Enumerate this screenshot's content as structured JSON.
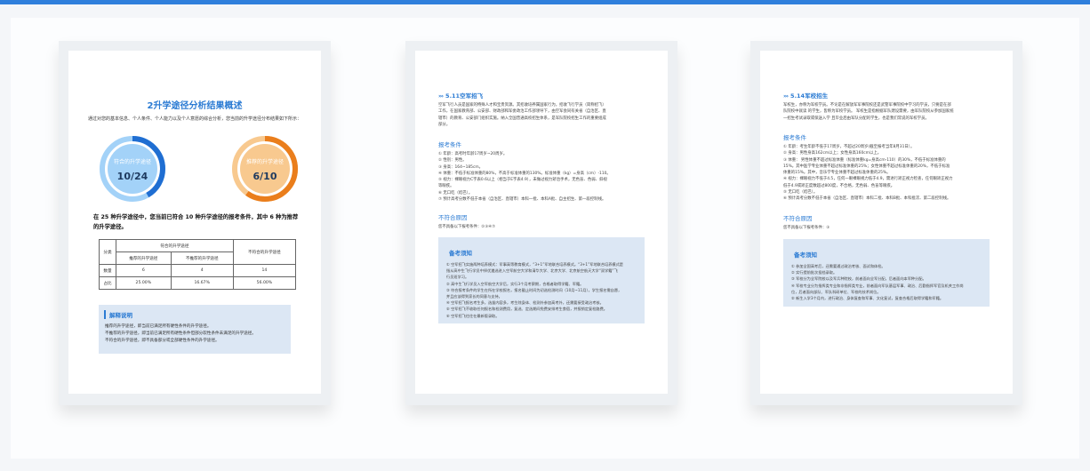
{
  "colors": {
    "accent": "#2b7bd3",
    "ring_blue_dark": "#1f6ed2",
    "ring_blue_light": "#a3d2f8",
    "ring_orange_dark": "#ea7e1c",
    "ring_orange_light": "#f8c98f",
    "note_bg": "#dce7f4"
  },
  "page1": {
    "title": "2升学途径分析结果概述",
    "intro": "通过对您的基本信息、个人条件、个人能力以及个人意愿的综合分析，您当前的升学途径分布结果如下所示：",
    "ring_match": {
      "label": "符合的升学途径",
      "value": "10/24",
      "fraction": 0.4167
    },
    "ring_recommend": {
      "label": "推荐的升学途径",
      "value": "6/10",
      "fraction": 0.6
    },
    "summary": "在 25 种升学途径中，您当前已符合 10 种升学途径的报考条件，其中 6 种为推荐的升学途径。",
    "table": {
      "head_category": "分类",
      "head_match": "符合的升学途径",
      "head_recommend": "推荐的升学途径",
      "head_not_recommend": "不推荐的升学途径",
      "head_not_match": "不符合的升学途径",
      "row_count": {
        "label": "数量",
        "recommend": "6",
        "not_recommend": "4",
        "not_match": "14"
      },
      "row_ratio": {
        "label": "占比",
        "recommend": "25.00%",
        "not_recommend": "16.67%",
        "not_match": "56.00%"
      }
    },
    "explain": {
      "title": "解释说明",
      "lines": [
        "推荐的升学途径，即当前已满足所有硬性条件的升学途径。",
        "不推荐的升学途径，即当前已满足所有硬性条件但部分软性条件未满足的升学途径。",
        "不符合的升学途径，即不具备部分或全部硬性条件的升学途径。"
      ]
    }
  },
  "page2": {
    "section": "5.11空军招飞",
    "intro": [
      "空军飞行人员是国家的特殊人才和宝贵资源。其招收培养属国家行为，招收飞行学员（简称招飞）",
      "工作，在国家教育部、公安部、财政部和军委政治工作部领导下，由空军会同有关省（自治区、直",
      "辖市）的教育、公安部门组织实施。纳入全国普通高校招生体系，是军队院校招生工作的重要组成",
      "部分。"
    ],
    "cond_title": "报考条件",
    "conditions": [
      "① 年龄：高考时年龄17周岁~20周岁。",
      "② 性别：男性。",
      "③ 身高：164~185cm。",
      "④ 体重：不低于标准体重的80%，不高于标准体重的130%。标准体重（kg）=身高（cm）-110。",
      "⑤ 视力：裸眼视力C字表0.6以上（相当于E字表4.9），未做过视力矫治手术，无色盲、色弱、斜视",
      "等眼疾。",
      "⑥ 无口吃（结巴）。",
      "⑦ 预计高考分数不低于本省（自治区、直辖市）本科一批、本科A批、自主招生、第一段控制线。"
    ],
    "unmet_title": "不符合原因",
    "unmet": "您不具备以下报考条件：②③④⑦",
    "notice": {
      "title": "备考须知",
      "lines": [
        "① 空军招飞实施两种培养模式：军事高等教育模式，“3+1”军地联合培养模式。“3+1”军地联合培养模式是",
        "指从高中生飞行学员中择优遴选进入空军航空大学和清华大学、北京大学、北京航空航天大学“双学籍”飞",
        "行员班学习。",
        "② 高中生飞行学员入空军航空大学后，实行3个月考察期，合格者取得学籍、军籍。",
        "③ 符合报考条件的学生在所在学校报名，报名截止时间为初选检测时间（10月~11月），学生报名需自愿，",
        "并且应该得到家长的同意与支持。",
        "④ 空军招飞报名考生多，选拔内容多，考生除身体、检测外参加高考外，还需要接受政治考核。",
        "⑤ 空军招飞不收取任何报名和检测费用，复选、定选期间免费安排考生食宿，并报销定复检路费。",
        "⑥ 空军招飞往往在最新版录取。"
      ]
    }
  },
  "page3": {
    "section": "5.14军校招生",
    "intro": [
      "军校生，亦称为军校学员。不论是在解放军军事院校还是武警军事院校中学习的学员，只要是在部",
      "队院校中就读 的学生，皆称为军校学员。 军校生是指根据军队建设需要，由军队院校从参加国家统",
      "一招生考试录取或保送入学 且毕业后由军队分配的学生，也是我们常说的军校学员。"
    ],
    "cond_title": "报考条件",
    "conditions": [
      "① 年龄：考生年龄不低于17周岁，不超过20周岁(截至报考当年8月31日）。",
      "② 身高：男性身高162cm以上；女性身高160cm以上。",
      "③ 体重： 男性体重不超过标准体重（标准体重kg=身高cm-110）的30%，不低于标准体重的",
      "15%。其中医学专业体重不超过标准体重的25%；女性体重不超过标准体重的20%，不低于标准",
      "体重的15%。其中，音乐学专业体重不超过标准体重的25%。",
      "④ 视力：裸眼视力不低于4.5，任何一眼裸眼视力低于4.9，需进行矫正视力检查，任何眼矫正视力",
      "低于4.9或矫正度数超过800度，不合格，无色弱、色盲等眼疾。",
      "⑤ 无口吃（结巴）。",
      "⑥ 预计高考分数不低于本省（自治区、直辖市）本科二批、本科B批、本科批次、第二段控制线。"
    ],
    "unmet_title": "不符合原因",
    "unmet": "您不具备以下报考条件：③",
    "notice": {
      "title": "备考须知",
      "lines": [
        "① 参加全国高考后，还需要通过政治考核、面试和体检。",
        "② 实行提前批次投档录取。",
        "③ 军校分为全军院校以及军兵种院校，前者面向全军分配，后者面向本军种分配。",
        "④ 军校专业分为指挥类专业和非指挥类专业，前者面向军队基层军事、政治、后勤指挥军官及机关工作岗",
        "位，后者面向部队、军队科研单位、军校的技术岗位。",
        "⑤ 新生入学3个月内，进行政治、身体复查和军事、文化复试，复查合格后取得学籍和军籍。"
      ]
    }
  }
}
